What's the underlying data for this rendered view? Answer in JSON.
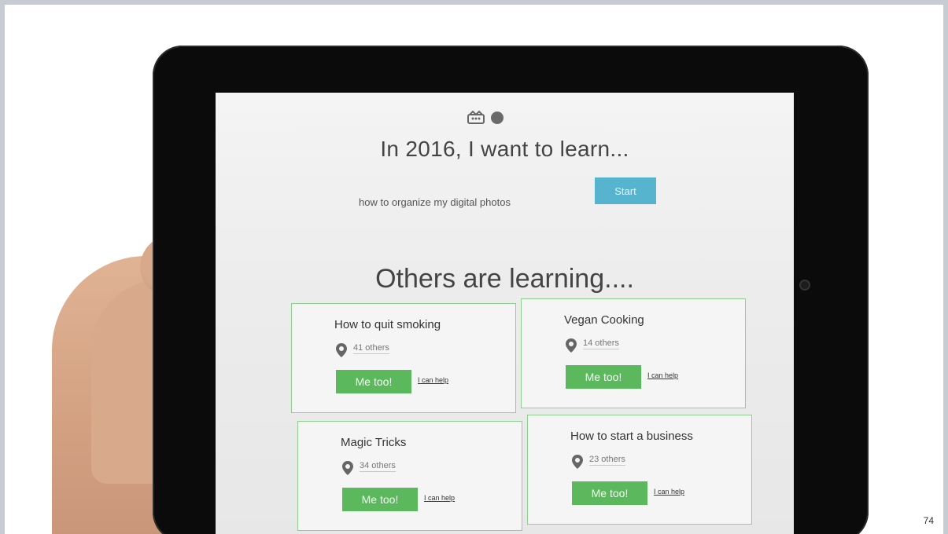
{
  "header": {
    "headline": "In 2016, I want to learn...",
    "logo_icons": [
      "crown-icon",
      "badge-icon"
    ]
  },
  "search": {
    "value": "how to organize my digital photos",
    "start_label": "Start"
  },
  "section_title": "Others are learning....",
  "cards": [
    {
      "title": "How to quit smoking",
      "others": "41 others",
      "me_too": "Me too!",
      "help": "I can help"
    },
    {
      "title": "Vegan Cooking",
      "others": "14 others",
      "me_too": "Me too!",
      "help": "I can help"
    },
    {
      "title": "Magic Tricks",
      "others": "34 others",
      "me_too": "Me too!",
      "help": "I can help"
    },
    {
      "title": "How to start a business",
      "others": "23 others",
      "me_too": "Me too!",
      "help": "I can help"
    }
  ],
  "page_number": "74",
  "colors": {
    "start_button": "#56b4cf",
    "metoo_button": "#5cb85c",
    "card_border": "#8fcf8f",
    "tablet_bezel": "#0b0b0b"
  }
}
